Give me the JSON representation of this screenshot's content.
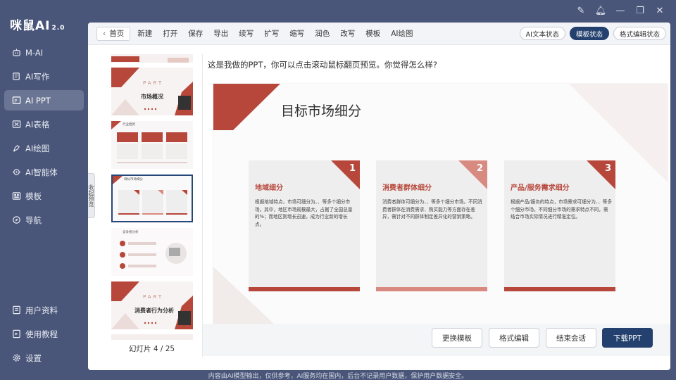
{
  "app": {
    "logo": "咪鼠AI",
    "version": "2.0"
  },
  "sidebar": {
    "items": [
      {
        "label": "M-AI",
        "icon": "robot-icon",
        "active": false
      },
      {
        "label": "AI写作",
        "icon": "edit-icon",
        "active": false
      },
      {
        "label": "AI PPT",
        "icon": "ppt-icon",
        "active": true
      },
      {
        "label": "AI表格",
        "icon": "table-icon",
        "active": false
      },
      {
        "label": "AI绘图",
        "icon": "paint-icon",
        "active": false
      },
      {
        "label": "AI智能体",
        "icon": "agent-icon",
        "active": false
      },
      {
        "label": "模板",
        "icon": "template-icon",
        "active": false
      },
      {
        "label": "导航",
        "icon": "compass-icon",
        "active": false
      }
    ],
    "bottom_items": [
      {
        "label": "用户资料",
        "icon": "profile-icon"
      },
      {
        "label": "使用教程",
        "icon": "tutorial-icon"
      },
      {
        "label": "设置",
        "icon": "gear-icon"
      }
    ]
  },
  "toolbar": {
    "home": "首页",
    "tools": [
      "新建",
      "打开",
      "保存",
      "导出",
      "续写",
      "扩写",
      "缩写",
      "润色",
      "改写",
      "模板",
      "AI绘图"
    ],
    "status_buttons": [
      {
        "label": "AI文本状态",
        "active": false
      },
      {
        "label": "模板状态",
        "active": true
      },
      {
        "label": "格式编辑状态",
        "active": false
      }
    ]
  },
  "thumbnails": {
    "collapse_label": "收起预览",
    "counter": "幻灯片 4 / 25",
    "current": 4,
    "total": 25,
    "items": [
      {
        "part": "PART",
        "title": "市场概况"
      },
      {
        "subtitle": "行业趋势"
      },
      {
        "subtitle": "目标市场细分"
      },
      {
        "subtitle": "竞争者分析"
      },
      {
        "part": "PART",
        "title": "消费者行为分析"
      }
    ]
  },
  "chat": {
    "message": "这是我做的PPT，你可以点击滚动鼠标翻页预览。你觉得怎么样?"
  },
  "slide": {
    "title": "目标市场细分",
    "accent": "#b7473b",
    "cards": [
      {
        "num": "1",
        "title": "地域细分",
        "text": "根据地域特点，市场可细分为、、等多个细分市场。其中，地区市场规模最大，占据了全国总量的%；而地区则增长迅速，成为行业新的增长点。"
      },
      {
        "num": "2",
        "title": "消费者群体细分",
        "text": "消费者群体可细分为、、等多个细分市场。不同消费者群体在消费需求、购买能力等方面存在差异，需针对不同群体制定差异化的营销策略。"
      },
      {
        "num": "3",
        "title": "产品/服务需求细分",
        "text": "根据产品/服务的特点，市场需求可细分为、、等多个细分市场。不同细分市场的需求特点不同，需结合市场实际情况进行精准定位。"
      }
    ]
  },
  "actions": {
    "change_template": "更换模板",
    "format_edit": "格式编辑",
    "end_session": "结束会话",
    "download": "下载PPT"
  },
  "footer": {
    "text": "内容由AI模型输出，仅供参考，AI服务均在国内，后台不记录用户数据，保护用户数据安全。"
  }
}
